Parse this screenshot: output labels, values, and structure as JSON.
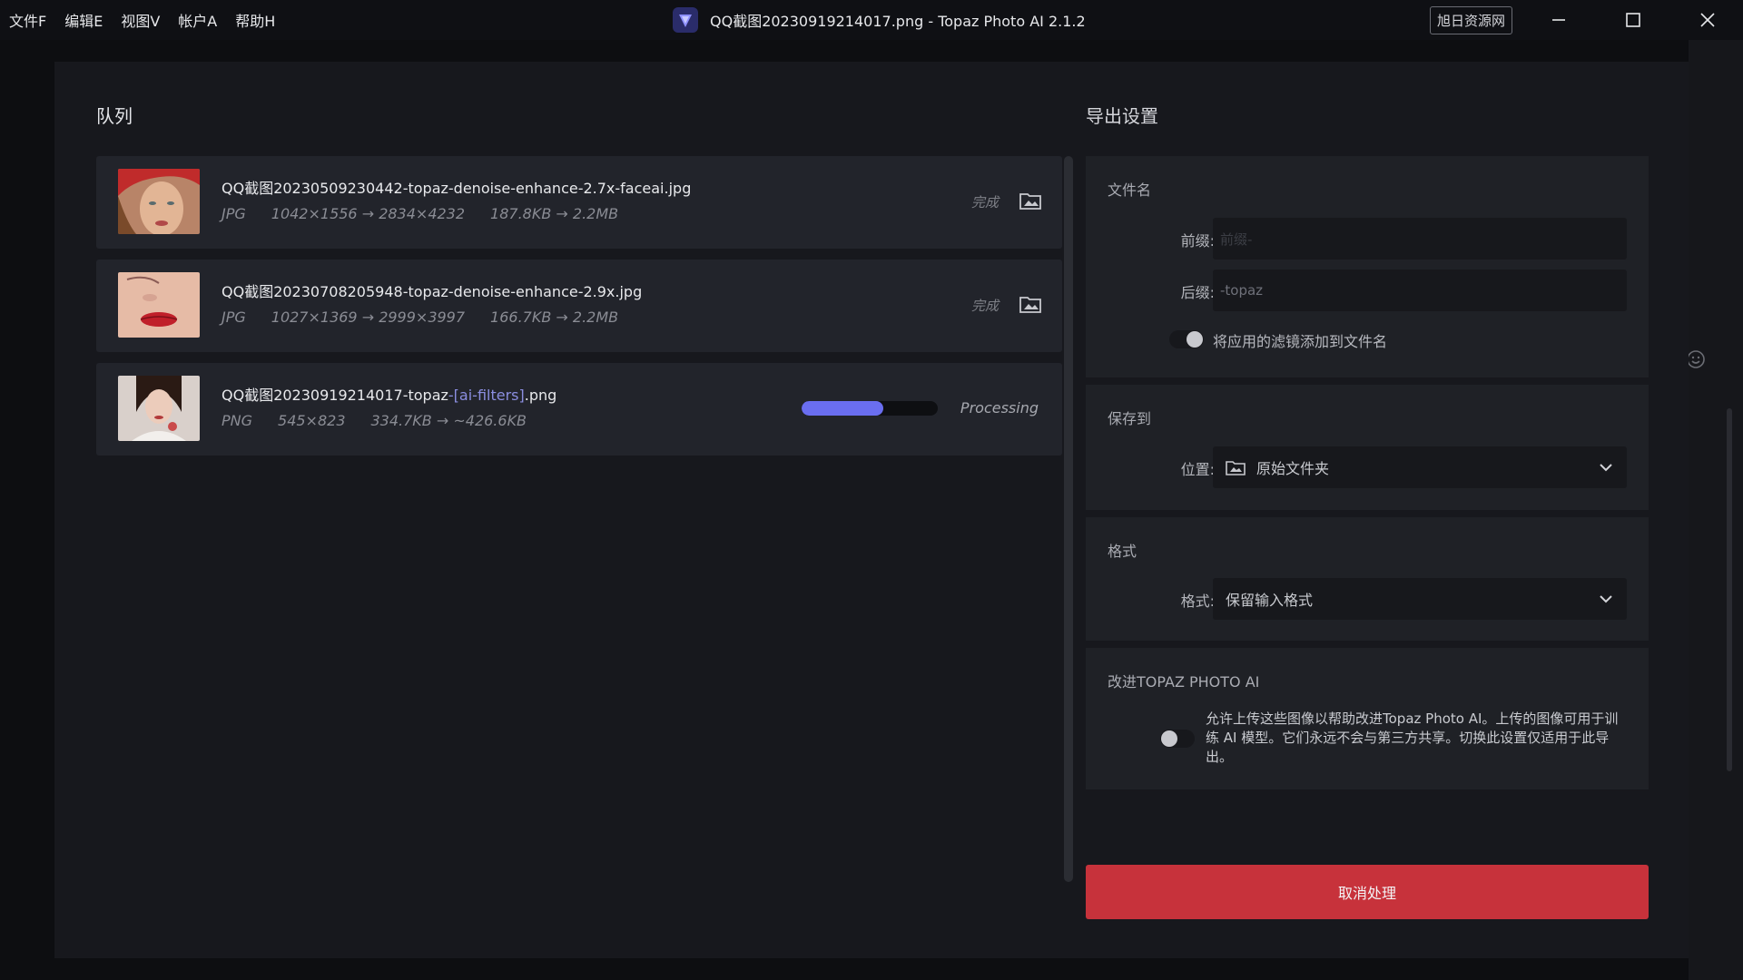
{
  "menu": [
    "文件F",
    "编辑E",
    "视图V",
    "帐户A",
    "帮助H"
  ],
  "window": {
    "title": "QQ截图20230919214017.png - Topaz Photo AI 2.1.2",
    "brand_button": "旭日资源网"
  },
  "colors": {
    "accent": "#6a6ef0",
    "cancel": "#c7323b",
    "panel": "#1f2126",
    "background": "#17181d"
  },
  "queue": {
    "title": "队列",
    "items": [
      {
        "name": "QQ截图20230509230442-topaz-denoise-enhance-2.7x-faceai.jpg",
        "name_tag": "",
        "name_ext": "",
        "format": "JPG",
        "dimensions": "1042×1556 → 2834×4232",
        "size": "187.8KB → 2.2MB",
        "status": "完成"
      },
      {
        "name": "QQ截图20230708205948-topaz-denoise-enhance-2.9x.jpg",
        "name_tag": "",
        "name_ext": "",
        "format": "JPG",
        "dimensions": "1027×1369 → 2999×3997",
        "size": "166.7KB → 2.2MB",
        "status": "完成"
      },
      {
        "name": "QQ截图20230919214017-topaz",
        "name_tag": "-[ai-filters]",
        "name_ext": ".png",
        "format": "PNG",
        "dimensions": "545×823",
        "size": "334.7KB → ~426.6KB",
        "status": "Processing",
        "progress": 0.6
      }
    ]
  },
  "export": {
    "title": "导出设置",
    "filename": {
      "section": "文件名",
      "prefix_label": "前缀:",
      "prefix_placeholder": "前缀-",
      "suffix_label": "后缀:",
      "suffix_value": "-topaz",
      "filter_toggle_label": "将应用的滤镜添加到文件名",
      "filter_toggle_on": false
    },
    "save_to": {
      "section": "保存到",
      "location_label": "位置:",
      "location_value": "原始文件夹"
    },
    "format": {
      "section": "格式",
      "format_label": "格式:",
      "format_value": "保留输入格式"
    },
    "improve": {
      "section": "改进TOPAZ PHOTO AI",
      "description": "允许上传这些图像以帮助改进Topaz Photo AI。上传的图像可用于训练 AI 模型。它们永远不会与第三方共享。切换此设置仅适用于此导出。",
      "toggle_on": false
    }
  },
  "cancel_button": "取消处理"
}
